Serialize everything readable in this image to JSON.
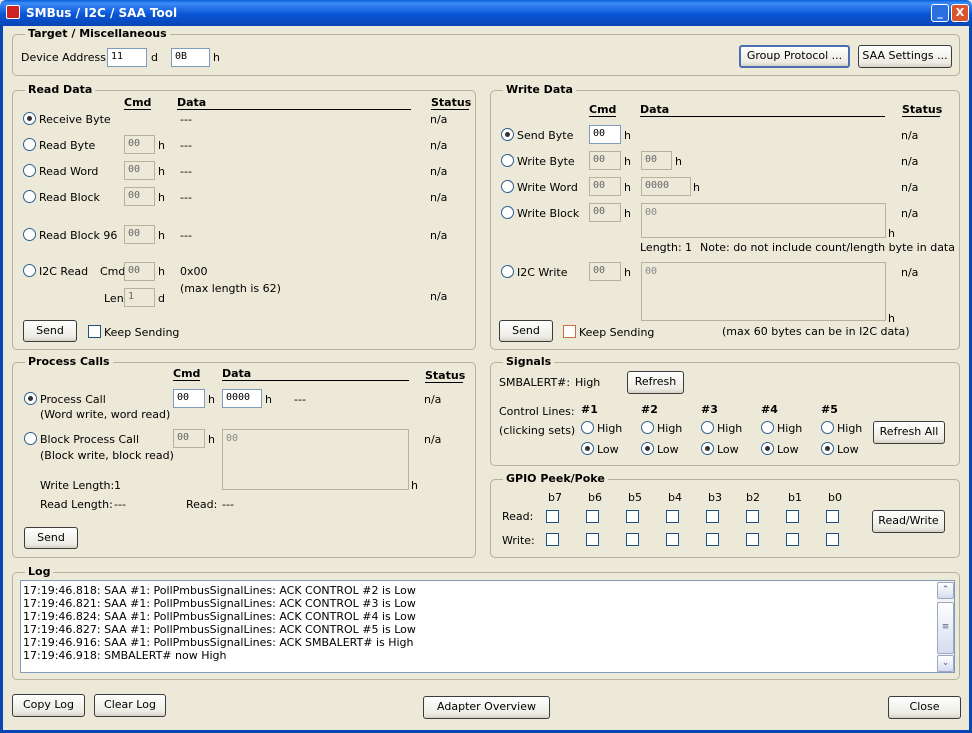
{
  "window": {
    "title": "SMBus / I2C / SAA Tool",
    "minimize": "_",
    "close": "X"
  },
  "target": {
    "title": "Target / Miscellaneous",
    "device_address_label": "Device Address:",
    "device_address_dec": "11",
    "dec_unit": "d",
    "device_address_hex": "0B",
    "hex_unit": "h",
    "group_protocol": "Group Protocol ...",
    "saa_settings": "SAA Settings ..."
  },
  "read": {
    "title": "Read Data",
    "col_cmd": "Cmd",
    "col_data": "Data",
    "col_status": "Status",
    "receive_byte": "Receive Byte",
    "read_byte": "Read Byte",
    "read_word": "Read Word",
    "read_block": "Read Block",
    "read_block96": "Read Block 96",
    "i2c_read": "I2C Read",
    "cmd_val": "00",
    "h": "h",
    "d": "d",
    "dashes": "---",
    "na": "n/a",
    "i2c_cmd_label": "Cmd",
    "i2c_len_label": "Len",
    "len_val": "1",
    "i2c_data": "0x00",
    "max_len": "(max length is 62)",
    "send": "Send",
    "keep_sending": "Keep Sending"
  },
  "write": {
    "title": "Write Data",
    "col_cmd": "Cmd",
    "col_data": "Data",
    "col_status": "Status",
    "send_byte": "Send Byte",
    "write_byte": "Write Byte",
    "write_word": "Write Word",
    "write_block": "Write Block",
    "i2c_write": "I2C Write",
    "cmd_val": "00",
    "word_val": "0000",
    "h": "h",
    "na": "n/a",
    "length_label": "Length:",
    "length_val": "1",
    "note": "Note: do not include count/length byte in data",
    "max_note": "(max 60 bytes can be in I2C data)",
    "send": "Send",
    "keep_sending": "Keep Sending"
  },
  "process": {
    "title": "Process Calls",
    "col_cmd": "Cmd",
    "col_data": "Data",
    "col_status": "Status",
    "process_call": "Process Call",
    "process_call_sub": "(Word write, word read)",
    "block_process_call": "Block Process Call",
    "block_process_call_sub": "(Block write, block read)",
    "cmd_val": "00",
    "word_val": "0000",
    "h": "h",
    "dashes": "---",
    "na": "n/a",
    "write_length_label": "Write Length:",
    "write_length_val": "1",
    "read_length_label": "Read Length:",
    "read_length_val": "---",
    "read_label": "Read:",
    "read_val": "---",
    "send": "Send"
  },
  "signals": {
    "title": "Signals",
    "smbalert_label": "SMBALERT#:",
    "smbalert_val": "High",
    "refresh": "Refresh",
    "control_lines": "Control Lines:",
    "clicking_sets": "(clicking sets)",
    "lines": [
      "#1",
      "#2",
      "#3",
      "#4",
      "#5"
    ],
    "high": "High",
    "low": "Low",
    "refresh_all": "Refresh All"
  },
  "gpio": {
    "title": "GPIO Peek/Poke",
    "bits": [
      "b7",
      "b6",
      "b5",
      "b4",
      "b3",
      "b2",
      "b1",
      "b0"
    ],
    "read_label": "Read:",
    "write_label": "Write:",
    "read_write": "Read/Write"
  },
  "log": {
    "title": "Log",
    "lines": [
      "17:19:46.818: SAA #1: PollPmbusSignalLines: ACK CONTROL #2 is Low",
      "17:19:46.821: SAA #1: PollPmbusSignalLines: ACK CONTROL #3 is Low",
      "17:19:46.824: SAA #1: PollPmbusSignalLines: ACK CONTROL #4 is Low",
      "17:19:46.827: SAA #1: PollPmbusSignalLines: ACK CONTROL #5 is Low",
      "17:19:46.916: SAA #1: PollPmbusSignalLines: ACK SMBALERT# is High",
      "17:19:46.918: SMBALERT# now High"
    ]
  },
  "footer": {
    "copy_log": "Copy Log",
    "clear_log": "Clear Log",
    "adapter_overview": "Adapter Overview",
    "close": "Close"
  }
}
